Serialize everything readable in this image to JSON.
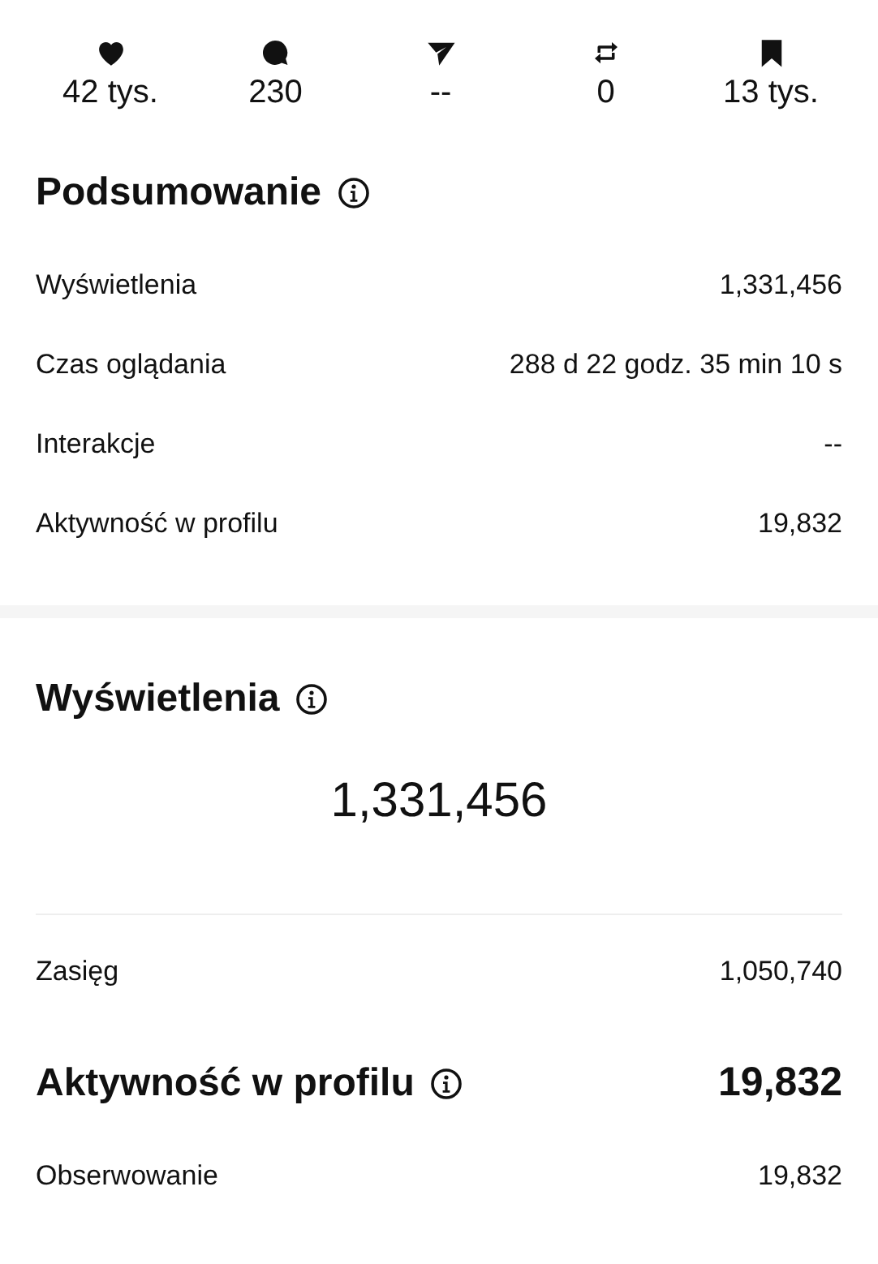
{
  "stats": [
    {
      "kind": "likes",
      "value": "42 tys."
    },
    {
      "kind": "comments",
      "value": "230"
    },
    {
      "kind": "shares",
      "value": "--"
    },
    {
      "kind": "reposts",
      "value": "0"
    },
    {
      "kind": "saves",
      "value": "13 tys."
    }
  ],
  "summary": {
    "title": "Podsumowanie",
    "rows": [
      {
        "label": "Wyświetlenia",
        "value": "1,331,456"
      },
      {
        "label": "Czas oglądania",
        "value": "288 d 22 godz. 35 min 10 s"
      },
      {
        "label": "Interakcje",
        "value": "--"
      },
      {
        "label": "Aktywność w profilu",
        "value": "19,832"
      }
    ]
  },
  "views": {
    "title": "Wyświetlenia",
    "total": "1,331,456",
    "rows": [
      {
        "label": "Zasięg",
        "value": "1,050,740"
      }
    ]
  },
  "profile_activity": {
    "title": "Aktywność w profilu",
    "total": "19,832",
    "rows": [
      {
        "label": "Obserwowanie",
        "value": "19,832"
      }
    ]
  }
}
